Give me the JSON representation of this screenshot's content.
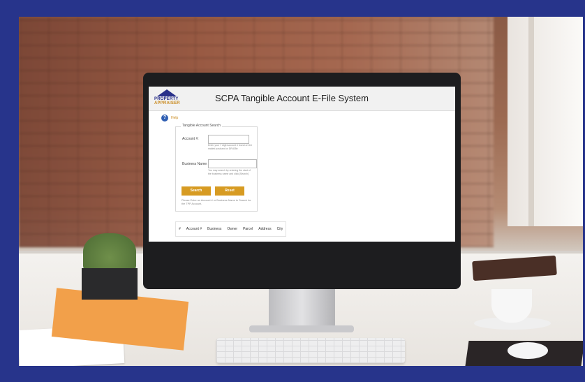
{
  "app": {
    "title": "SCPA Tangible Account E-File System",
    "logo_text_top": "PROPERTY",
    "logo_text_bottom": "APPRAISER"
  },
  "help": {
    "label": "Help",
    "icon": "question-circle-icon"
  },
  "search": {
    "legend": "Tangible Account Search",
    "account_label": "Account #:",
    "account_value": "",
    "account_hint": "Enter your 7 digit Account # found on the mailed postcard or DR405e",
    "business_label": "Business Name:",
    "business_value": "",
    "business_hint": "You may search by entering the start of the business name and click [Search]",
    "search_button": "Search",
    "reset_button": "Reset",
    "note": "Please Enter an Account # or Business Name to Search for the TPP Account."
  },
  "table": {
    "columns": [
      "#",
      "Account #",
      "Business",
      "Owner",
      "Parcel",
      "Address",
      "City"
    ]
  },
  "colors": {
    "accent": "#d79b22",
    "brand_blue": "#29308a",
    "border_blue": "#27348b"
  }
}
